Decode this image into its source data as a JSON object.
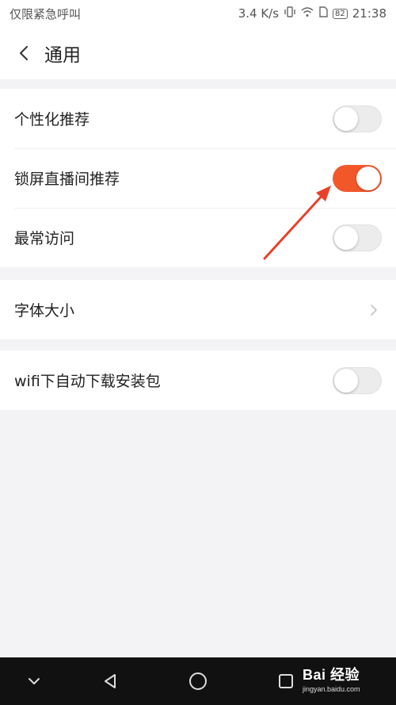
{
  "status_bar": {
    "carrier": "仅限紧急呼叫",
    "speed": "3.4 K/s",
    "battery": "82",
    "time": "21:38"
  },
  "header": {
    "title": "通用"
  },
  "settings": {
    "personalized_recommend": {
      "label": "个性化推荐",
      "enabled": false
    },
    "lockscreen_live_recommend": {
      "label": "锁屏直播间推荐",
      "enabled": true
    },
    "frequent_visits": {
      "label": "最常访问",
      "enabled": false
    },
    "font_size": {
      "label": "字体大小"
    },
    "wifi_auto_download": {
      "label": "wifi下自动下载安装包",
      "enabled": false
    }
  },
  "colors": {
    "toggle_on": "#f2572a",
    "annotation_arrow": "#e8402a"
  },
  "watermark": {
    "main": "Bai 经验",
    "sub": "jingyan.baidu.com"
  }
}
